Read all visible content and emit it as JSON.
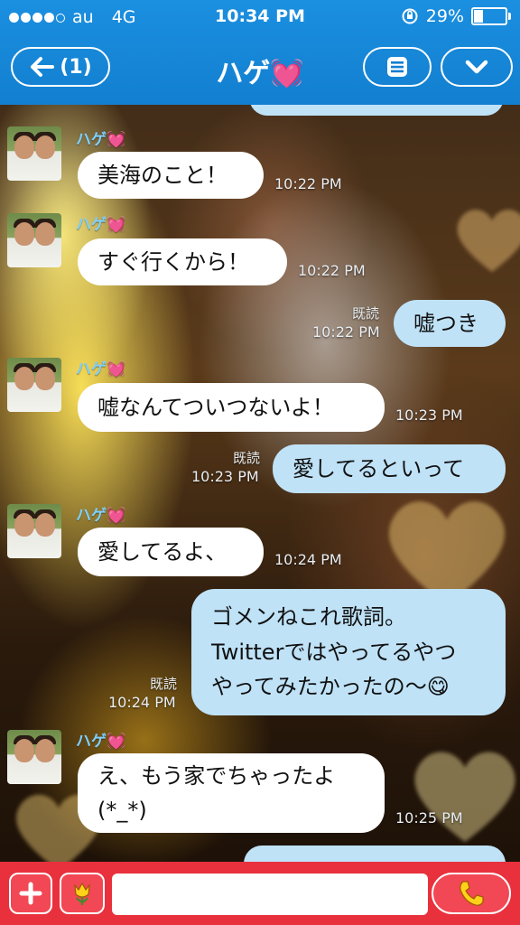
{
  "status_bar": {
    "signal": "●●●●○",
    "carrier": "au",
    "network": "4G",
    "time": "10:34 PM",
    "battery_text": "29%",
    "battery_level": 0.29
  },
  "header": {
    "back_label": "(1)",
    "title": "ハゲ💓"
  },
  "messages": [
    {
      "side": "in",
      "sender": "ハゲ💓",
      "text": "美海のこと！",
      "time": "10:22 PM"
    },
    {
      "side": "in",
      "sender": "ハゲ💓",
      "text": "すぐ行くから！",
      "time": "10:22 PM"
    },
    {
      "side": "out",
      "read": "既読",
      "text": "嘘つき",
      "time": "10:22 PM"
    },
    {
      "side": "in",
      "sender": "ハゲ💓",
      "text": "嘘なんてついつないよ！",
      "time": "10:23 PM"
    },
    {
      "side": "out",
      "read": "既読",
      "text": "愛してるといって",
      "time": "10:23 PM"
    },
    {
      "side": "in",
      "sender": "ハゲ💓",
      "text": "愛してるよ、",
      "time": "10:24 PM"
    },
    {
      "side": "out",
      "read": "既読",
      "lines": [
        "ゴメンねこれ歌詞。",
        "Twitterではやってるやつ",
        "やってみたかったの〜😋"
      ],
      "time": "10:24 PM"
    },
    {
      "side": "in",
      "sender": "ハゲ💓",
      "lines": [
        "え、もう家でちゃったよ",
        "(*_*)"
      ],
      "time": "10:25 PM"
    }
  ],
  "colors": {
    "header": "#137fd0",
    "incoming": "#ffffff",
    "outgoing": "#bfe2f7",
    "input_bar": "#e8313d",
    "sender_name": "#7fd0ff"
  },
  "icons": {
    "back": "arrow-left-icon",
    "menu": "list-icon",
    "dropdown": "chevron-down-icon",
    "add": "plus-icon",
    "stamp": "tulip-icon",
    "call": "phone-icon"
  }
}
